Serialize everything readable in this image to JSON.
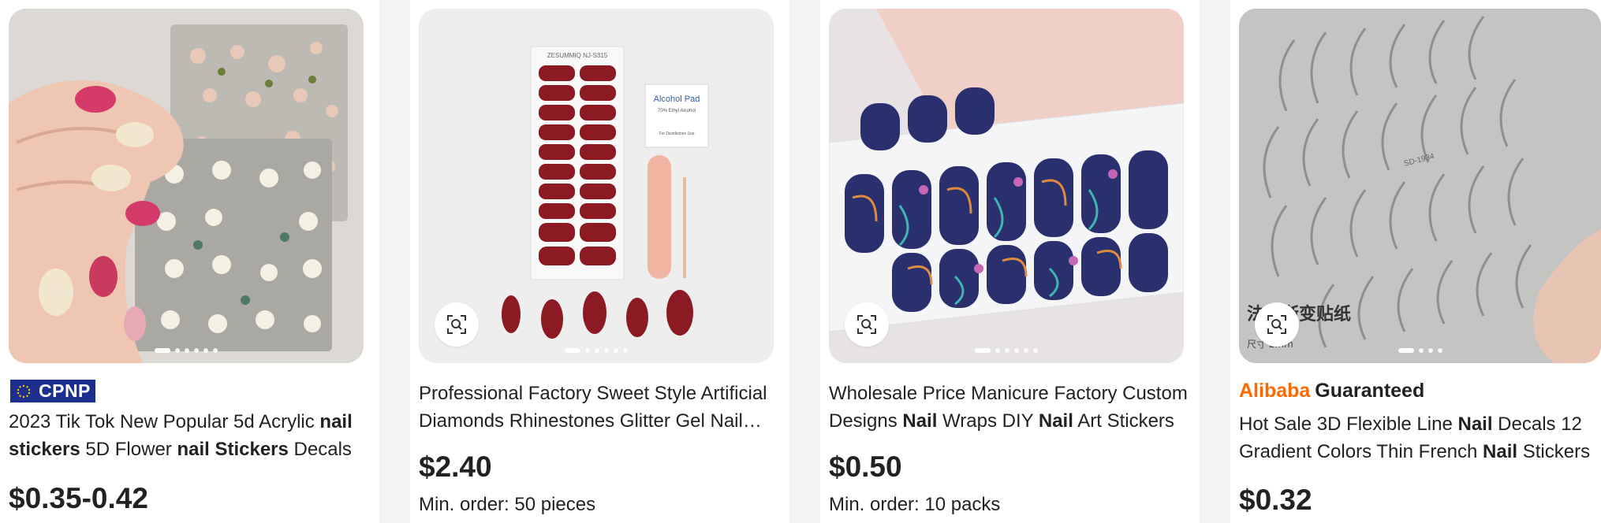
{
  "products": [
    {
      "badge": "CPNP",
      "title_parts": [
        {
          "text": "2023 Tik Tok New Popular 5d Acrylic ",
          "bold": false
        },
        {
          "text": "nail stickers",
          "bold": true
        },
        {
          "text": " 5D Flower ",
          "bold": false
        },
        {
          "text": "nail Stickers",
          "bold": true
        },
        {
          "text": " Decals",
          "bold": false
        }
      ],
      "price": "$0.35-0.42",
      "min_order": ""
    },
    {
      "title_parts": [
        {
          "text": "Professional Factory Sweet Style Artificial Diamonds Rhinestones Glitter Gel Nail Stickers",
          "bold": false
        }
      ],
      "price": "$2.40",
      "min_order": "Min. order: 50 pieces",
      "image_labels": {
        "sheet_code": "ZESUMMIQ NJ-S315",
        "pad_title": "Alcohol Pad",
        "pad_sub": "70% Ethyl Alcohol",
        "pad_foot": "For Disinfection Use"
      }
    },
    {
      "title_parts": [
        {
          "text": "Wholesale Price Manicure Factory Custom Designs ",
          "bold": false
        },
        {
          "text": "Nail",
          "bold": true
        },
        {
          "text": " Wraps DIY ",
          "bold": false
        },
        {
          "text": "Nail",
          "bold": true
        },
        {
          "text": " Art Stickers",
          "bold": false
        }
      ],
      "price": "$0.50",
      "min_order": "Min. order: 10 packs"
    },
    {
      "guarantee": {
        "brand": "Alibaba",
        "label": "Guaranteed"
      },
      "title_parts": [
        {
          "text": "Hot Sale 3D Flexible Line ",
          "bold": false
        },
        {
          "text": "Nail",
          "bold": true
        },
        {
          "text": " Decals 12 Gradient Colors Thin French ",
          "bold": false
        },
        {
          "text": "Nail",
          "bold": true
        },
        {
          "text": " Stickers",
          "bold": false
        }
      ],
      "price": "$0.32",
      "min_order": "",
      "image_labels": {
        "sheet_code": "SD-1934",
        "overlay_text": "法式渐变贴纸",
        "size_text": "尺寸 2mm"
      }
    }
  ],
  "icons": {
    "lens": "image-search-icon"
  },
  "colors": {
    "alibaba": "#ff6a00",
    "cpnp_bg": "#1c2f8f",
    "eu_stars": "#ffcc00"
  }
}
